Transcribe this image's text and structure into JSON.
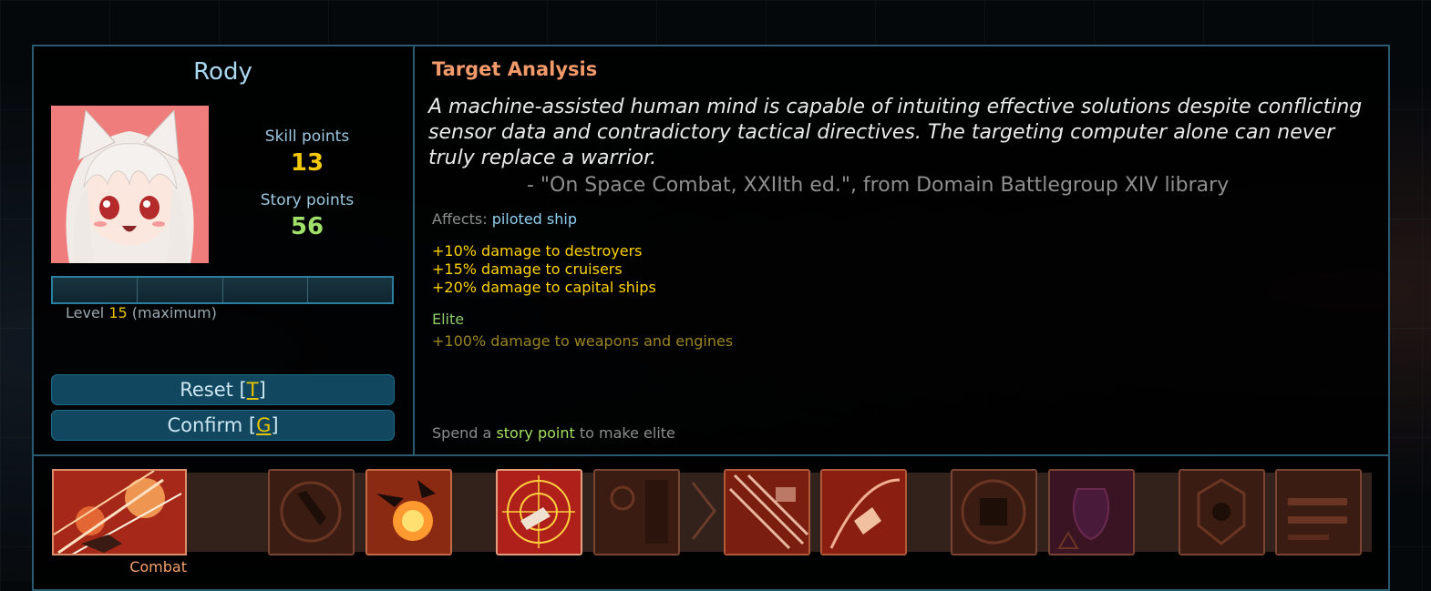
{
  "officer": {
    "name": "Rody",
    "skill_points_label": "Skill points",
    "skill_points": "13",
    "story_points_label": "Story points",
    "story_points": "56",
    "level_label": "Level",
    "level": "15",
    "level_note": "(maximum)",
    "level_progress": 1.0
  },
  "buttons": {
    "reset_label": "Reset [",
    "reset_key": "T",
    "reset_close": "]",
    "confirm_label": "Confirm [",
    "confirm_key": "G",
    "confirm_close": "]"
  },
  "skill": {
    "title": "Target Analysis",
    "quote": "A machine-assisted human mind is capable of intuiting effective solutions despite conflicting sensor data and contradictory tactical directives. The targeting computer alone can never truly replace a warrior.",
    "attribution": "- \"On Space Combat, XXIIth ed.\", from Domain Battlegroup XIV library",
    "affects_label": "Affects:",
    "affects_value": "piloted ship",
    "effects": [
      "+10% damage to destroyers",
      "+15% damage to cruisers",
      "+20% damage to capital ships"
    ],
    "elite_title": "Elite",
    "elite_effect": "+100% damage to weapons and engines",
    "spend_prefix": "Spend a",
    "spend_highlight": "story point",
    "spend_suffix": "to make elite"
  },
  "aptitude": {
    "label": "Combat"
  },
  "skill_icons": [
    {
      "name": "helmsmanship-icon",
      "state": "locked"
    },
    {
      "name": "combat-endurance-icon",
      "state": "learned"
    },
    {
      "name": "target-analysis-icon",
      "state": "selected"
    },
    {
      "name": "impact-mitigation-icon",
      "state": "locked"
    },
    {
      "name": "field-modulation-icon",
      "state": "learned"
    },
    {
      "name": "point-defense-icon",
      "state": "learned"
    },
    {
      "name": "damage-control-icon",
      "state": "locked"
    },
    {
      "name": "ordnance-expertise-icon",
      "state": "locked"
    },
    {
      "name": "systems-expertise-icon",
      "state": "locked"
    },
    {
      "name": "missile-specialization-icon",
      "state": "locked"
    }
  ],
  "colors": {
    "accent": "#2a5a70",
    "highlight": "#e7c200",
    "positive": "#8cc96a",
    "skill_title": "#f39a6b"
  }
}
